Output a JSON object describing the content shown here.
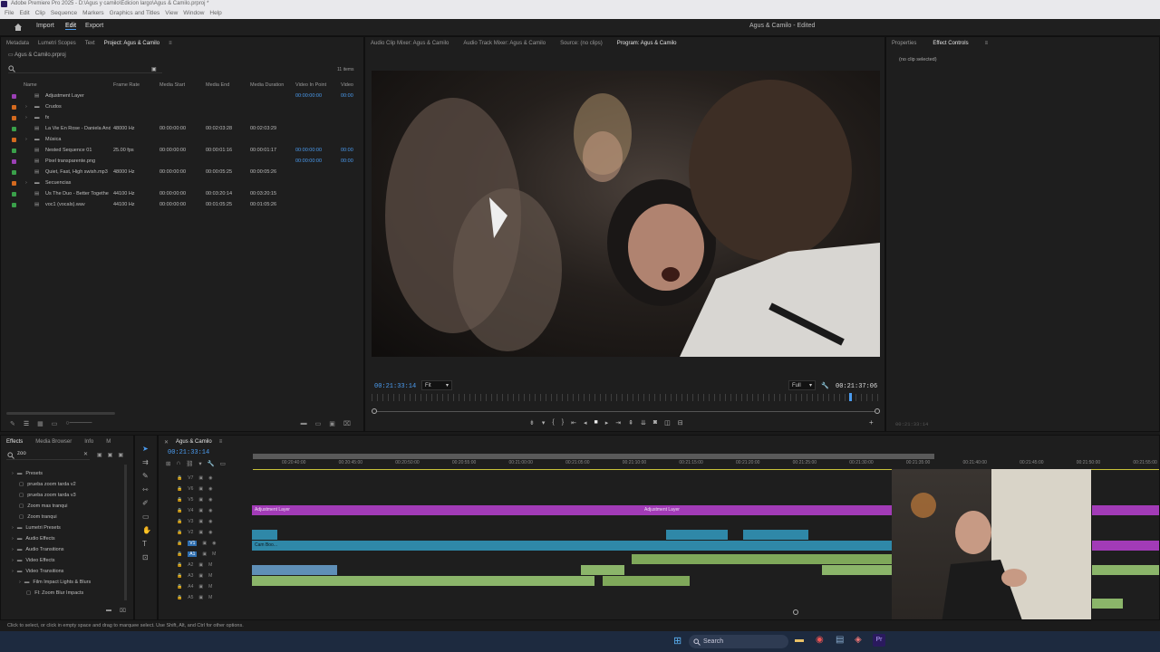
{
  "app": {
    "window_title": "Adobe Premiere Pro 2025 - D:\\Agus y camilo\\Edicion largo\\Agus & Camilo.prproj *",
    "menu": [
      "File",
      "Edit",
      "Clip",
      "Sequence",
      "Markers",
      "Graphics and Titles",
      "View",
      "Window",
      "Help"
    ],
    "workspace_tabs": [
      "Import",
      "Edit",
      "Export"
    ],
    "project_status": "Agus & Camilo - Edited"
  },
  "project_panel": {
    "tabs": [
      "Metadata",
      "Lumetri Scopes",
      "Text",
      "Project: Agus & Camilo"
    ],
    "file_name": "Agus & Camilo.prproj",
    "item_count": "11 items",
    "columns": [
      "Name",
      "Frame Rate",
      "Media Start",
      "Media End",
      "Media Duration",
      "Video In Point",
      "Video"
    ],
    "rows": [
      {
        "name": "Adjustment Layer",
        "fr": "",
        "start": "",
        "end": "",
        "dur": "",
        "vin": "00:00:00:00",
        "v": "00:00",
        "color": "#9b3fb5"
      },
      {
        "name": "Crudos",
        "fr": "",
        "start": "",
        "end": "",
        "dur": "",
        "vin": "",
        "v": "",
        "color": "#d46a1f"
      },
      {
        "name": "fx",
        "fr": "",
        "start": "",
        "end": "",
        "dur": "",
        "vin": "",
        "v": "",
        "color": "#d46a1f"
      },
      {
        "name": "La Vie En Rose - Daniela And",
        "fr": "48000 Hz",
        "start": "00:00:00:00",
        "end": "00:02:03:28",
        "dur": "00:02:03:29",
        "vin": "",
        "v": "",
        "color": "#3aa04a"
      },
      {
        "name": "Música",
        "fr": "",
        "start": "",
        "end": "",
        "dur": "",
        "vin": "",
        "v": "",
        "color": "#d46a1f"
      },
      {
        "name": "Nested Sequence 01",
        "fr": "25.00 fps",
        "start": "00:00:00:00",
        "end": "00:00:01:16",
        "dur": "00:00:01:17",
        "vin": "00:00:00:00",
        "v": "00:00",
        "color": "#3aa04a"
      },
      {
        "name": "Pixel transparente.png",
        "fr": "",
        "start": "",
        "end": "",
        "dur": "",
        "vin": "00:00:00:00",
        "v": "00:00",
        "color": "#9b3fb5"
      },
      {
        "name": "Quiet, Fast, High swish.mp3",
        "fr": "48000 Hz",
        "start": "00:00:00:00",
        "end": "00:00:05:25",
        "dur": "00:00:05:26",
        "vin": "",
        "v": "",
        "color": "#3aa04a"
      },
      {
        "name": "Secuencias",
        "fr": "",
        "start": "",
        "end": "",
        "dur": "",
        "vin": "",
        "v": "",
        "color": "#d46a1f"
      },
      {
        "name": "Us The Duo - Better Togethe",
        "fr": "44100 Hz",
        "start": "00:00:00:00",
        "end": "00:03:20:14",
        "dur": "00:03:20:15",
        "vin": "",
        "v": "",
        "color": "#3aa04a"
      },
      {
        "name": "voc1 (vocals).wav",
        "fr": "44100 Hz",
        "start": "00:00:00:00",
        "end": "00:01:05:25",
        "dur": "00:01:05:26",
        "vin": "",
        "v": "",
        "color": "#3aa04a"
      }
    ]
  },
  "monitor": {
    "tabs": [
      "Audio Clip Mixer: Agus & Camilo",
      "Audio Track Mixer: Agus & Camilo",
      "Source: (no clips)",
      "Program: Agus & Camilo"
    ],
    "current_time": "00:21:33:14",
    "fit": "Fit",
    "quality": "Full",
    "duration": "00:21:37:06"
  },
  "effect_controls": {
    "tabs": [
      "Properties",
      "Effect Controls"
    ],
    "empty": "(no clip selected)",
    "time": "00:21:33:14"
  },
  "effects_panel": {
    "tabs": [
      "Effects",
      "Media Browser",
      "Info",
      "M"
    ],
    "search": "zoo",
    "tree": [
      {
        "label": "Presets",
        "indent": 0,
        "type": "folder"
      },
      {
        "label": "prueba zoom tarda v2",
        "indent": 1,
        "type": "preset"
      },
      {
        "label": "prueba zoom tarda v3",
        "indent": 1,
        "type": "preset"
      },
      {
        "label": "Zoom mas tranqui",
        "indent": 1,
        "type": "preset"
      },
      {
        "label": "Zoom tranqui",
        "indent": 1,
        "type": "preset"
      },
      {
        "label": "Lumetri Presets",
        "indent": 0,
        "type": "folder"
      },
      {
        "label": "Audio Effects",
        "indent": 0,
        "type": "folder"
      },
      {
        "label": "Audio Transitions",
        "indent": 0,
        "type": "folder"
      },
      {
        "label": "Video Effects",
        "indent": 0,
        "type": "folder"
      },
      {
        "label": "Video Transitions",
        "indent": 0,
        "type": "folder"
      },
      {
        "label": "Film Impact Lights & Blurs",
        "indent": 1,
        "type": "folder"
      },
      {
        "label": "FI: Zoom Blur Impacts",
        "indent": 2,
        "type": "preset"
      }
    ]
  },
  "timeline": {
    "tab": "Agus & Camilo",
    "timecode": "00:21:33:14",
    "ruler": [
      "00:20:40:00",
      "00:20:45:00",
      "00:20:50:00",
      "00:20:55:00",
      "00:21:00:00",
      "00:21:05:00",
      "00:21:10:00",
      "00:21:15:00",
      "00:21:20:00",
      "00:21:25:00",
      "00:21:30:00",
      "00:21:35:00",
      "00:21:40:00",
      "00:21:45:00",
      "00:21:50:00",
      "00:21:55:00"
    ],
    "video_tracks": [
      "V7",
      "V6",
      "V5",
      "V4",
      "V3",
      "V2",
      "V1"
    ],
    "audio_tracks": [
      "A1",
      "A2",
      "A3",
      "A4",
      "A5"
    ],
    "adjustment_label": "Adjustment Layer",
    "clip_label": "Cam Boo..."
  },
  "status_bar": "Click to select, or click in empty space and drag to marquee select. Use Shift, Alt, and Ctrl for other options.",
  "taskbar": {
    "search": "Search"
  }
}
